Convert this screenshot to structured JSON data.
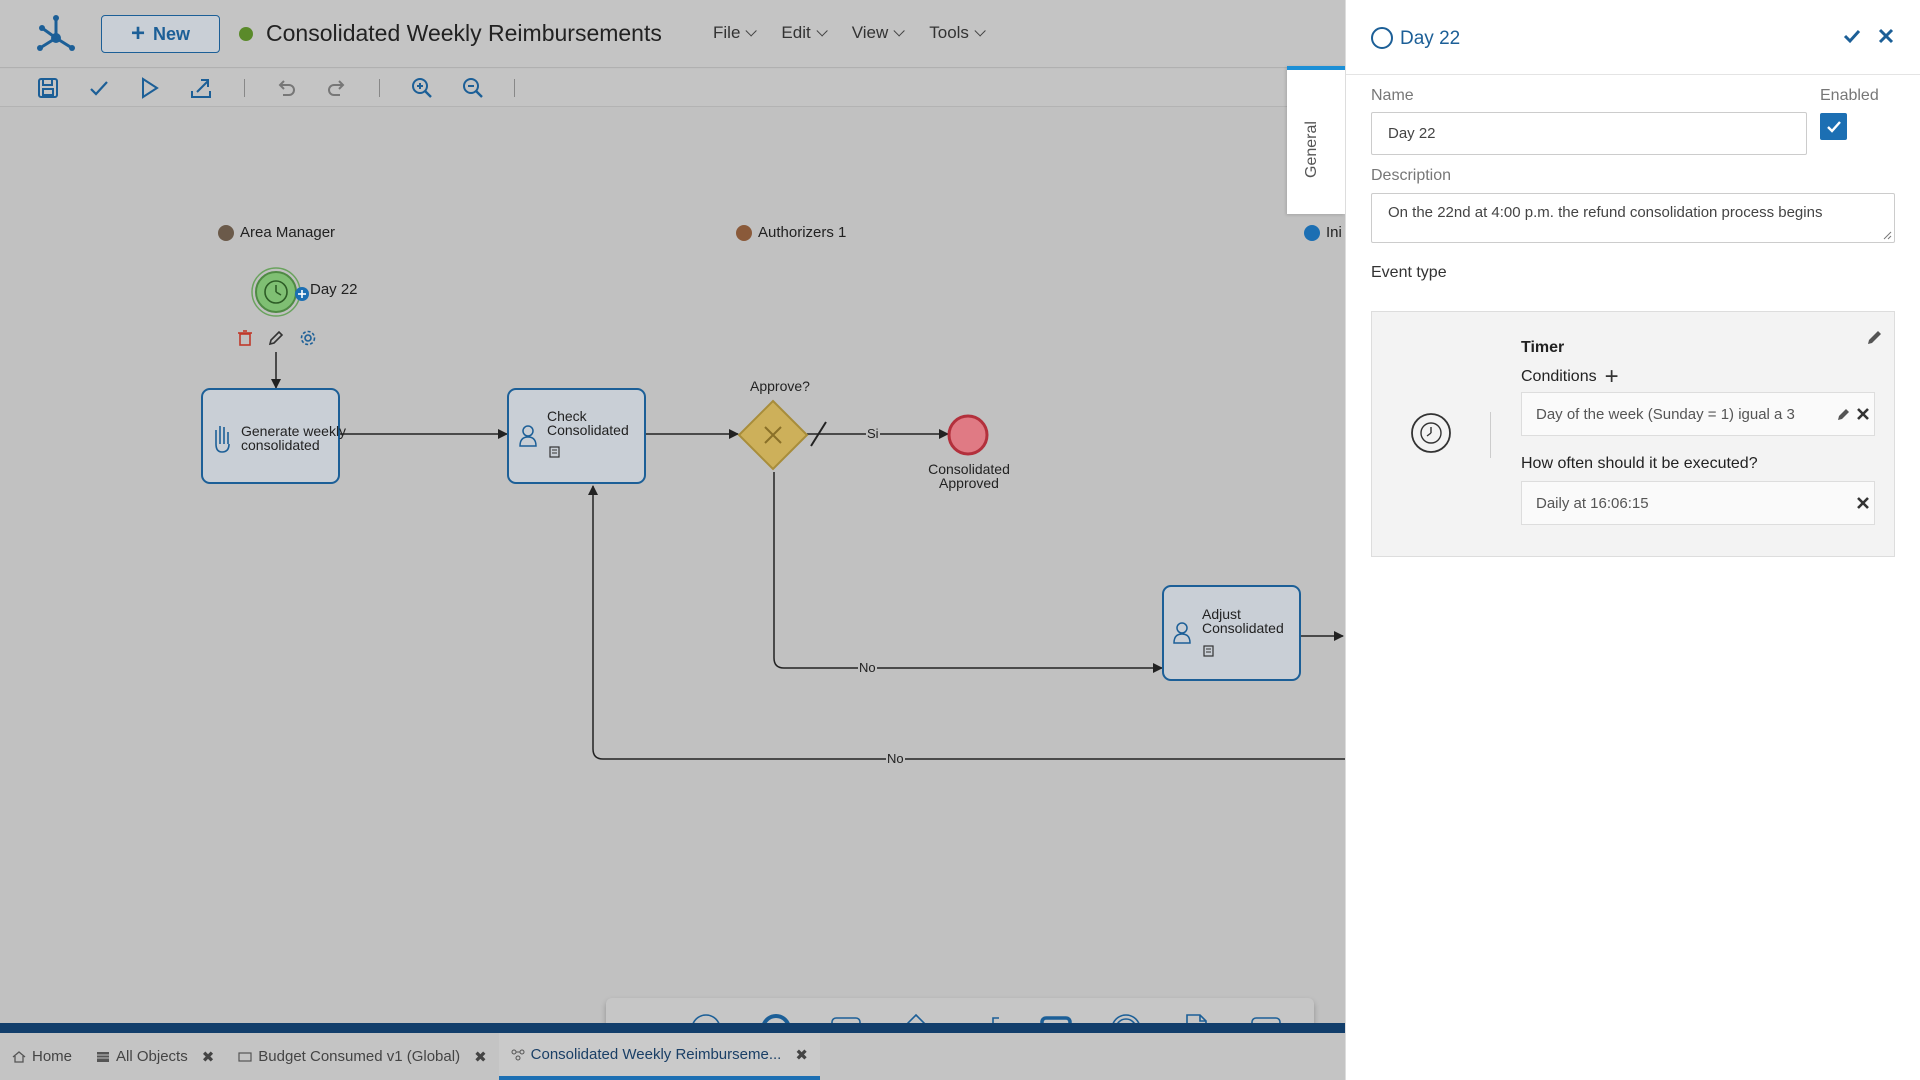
{
  "header": {
    "new_label": "New",
    "title": "Consolidated Weekly Reimbursements",
    "status_color": "#5a8a2a",
    "menus": [
      {
        "label": "File"
      },
      {
        "label": "Edit"
      },
      {
        "label": "View"
      },
      {
        "label": "Tools"
      }
    ]
  },
  "toolbar": {
    "icons": [
      "save-icon",
      "check-icon",
      "play-icon",
      "export-icon",
      "undo-icon",
      "redo-icon",
      "zoom-in-icon",
      "zoom-out-icon"
    ]
  },
  "diagram": {
    "lanes": [
      "Area Manager",
      "Authorizers 1",
      "Ini"
    ],
    "start_event": "Day 22",
    "tasks": {
      "generate": [
        "Generate weekly",
        "consolidated"
      ],
      "check": [
        "Check",
        "Consolidated"
      ],
      "adjust": [
        "Adjust",
        "Consolidated"
      ]
    },
    "gateway": "Approve?",
    "end_event": [
      "Consolidated",
      "Approved"
    ],
    "flows": {
      "si": "Si",
      "no1": "No",
      "no2": "No"
    }
  },
  "palette": {
    "items": [
      "more-icon",
      "start-event-icon",
      "end-event-icon",
      "task-icon",
      "gateway-icon",
      "annotation-icon",
      "subprocess-icon",
      "intermediate-event-icon",
      "data-object-icon",
      "pool-icon"
    ]
  },
  "bottom_tabs": [
    {
      "label": "Home",
      "closable": false
    },
    {
      "label": "All Objects",
      "closable": true
    },
    {
      "label": "Budget Consumed v1 (Global)",
      "closable": true
    },
    {
      "label": "Consolidated Weekly Reimburseme...",
      "closable": true,
      "active": true
    }
  ],
  "panel": {
    "title": "Day 22",
    "side_tab": "General",
    "name_label": "Name",
    "name_value": "Day 22",
    "enabled_label": "Enabled",
    "enabled": true,
    "description_label": "Description",
    "description_value": "On the 22nd at 4:00 p.m. the refund consolidation process begins",
    "event_type_label": "Event type",
    "timer": {
      "title": "Timer",
      "conditions_label": "Conditions",
      "condition_value": "Day of the week (Sunday = 1) igual a 3",
      "frequency_label": "How often should it be executed?",
      "frequency_value": "Daily at 16:06:15"
    }
  },
  "colors": {
    "accent": "#1c5f97",
    "accent_bright": "#1c8fd6",
    "task_fill": "#c9cfd6",
    "start_green": "#7fbf73",
    "end_red": "#e07a84",
    "gateway_yellow": "#cdb05a"
  }
}
